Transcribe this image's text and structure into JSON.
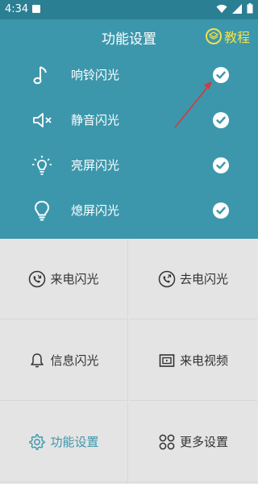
{
  "status": {
    "time": "4:34"
  },
  "header": {
    "title": "功能设置",
    "tutorial_label": "教程",
    "tutorial_icon": "layers-icon"
  },
  "flash_settings": [
    {
      "icon": "music-note-icon",
      "label": "响铃闪光",
      "checked": true
    },
    {
      "icon": "mute-icon",
      "label": "静音闪光",
      "checked": true
    },
    {
      "icon": "bulb-light-icon",
      "label": "亮屏闪光",
      "checked": true
    },
    {
      "icon": "bulb-off-icon",
      "label": "熄屏闪光",
      "checked": true
    }
  ],
  "grid": [
    {
      "icon": "incoming-call-icon",
      "label": "来电闪光"
    },
    {
      "icon": "outgoing-call-icon",
      "label": "去电闪光"
    },
    {
      "icon": "bell-icon",
      "label": "信息闪光"
    },
    {
      "icon": "video-icon",
      "label": "来电视频"
    },
    {
      "icon": "gear-icon",
      "label": "功能设置",
      "active": true
    },
    {
      "icon": "apps-icon",
      "label": "更多设置"
    }
  ],
  "colors": {
    "primary": "#3c97ac",
    "statusbar": "#2b7f92",
    "tutorial": "#f2e14b",
    "arrow": "#d33a3a",
    "grid_bg": "#e4e4e4"
  }
}
